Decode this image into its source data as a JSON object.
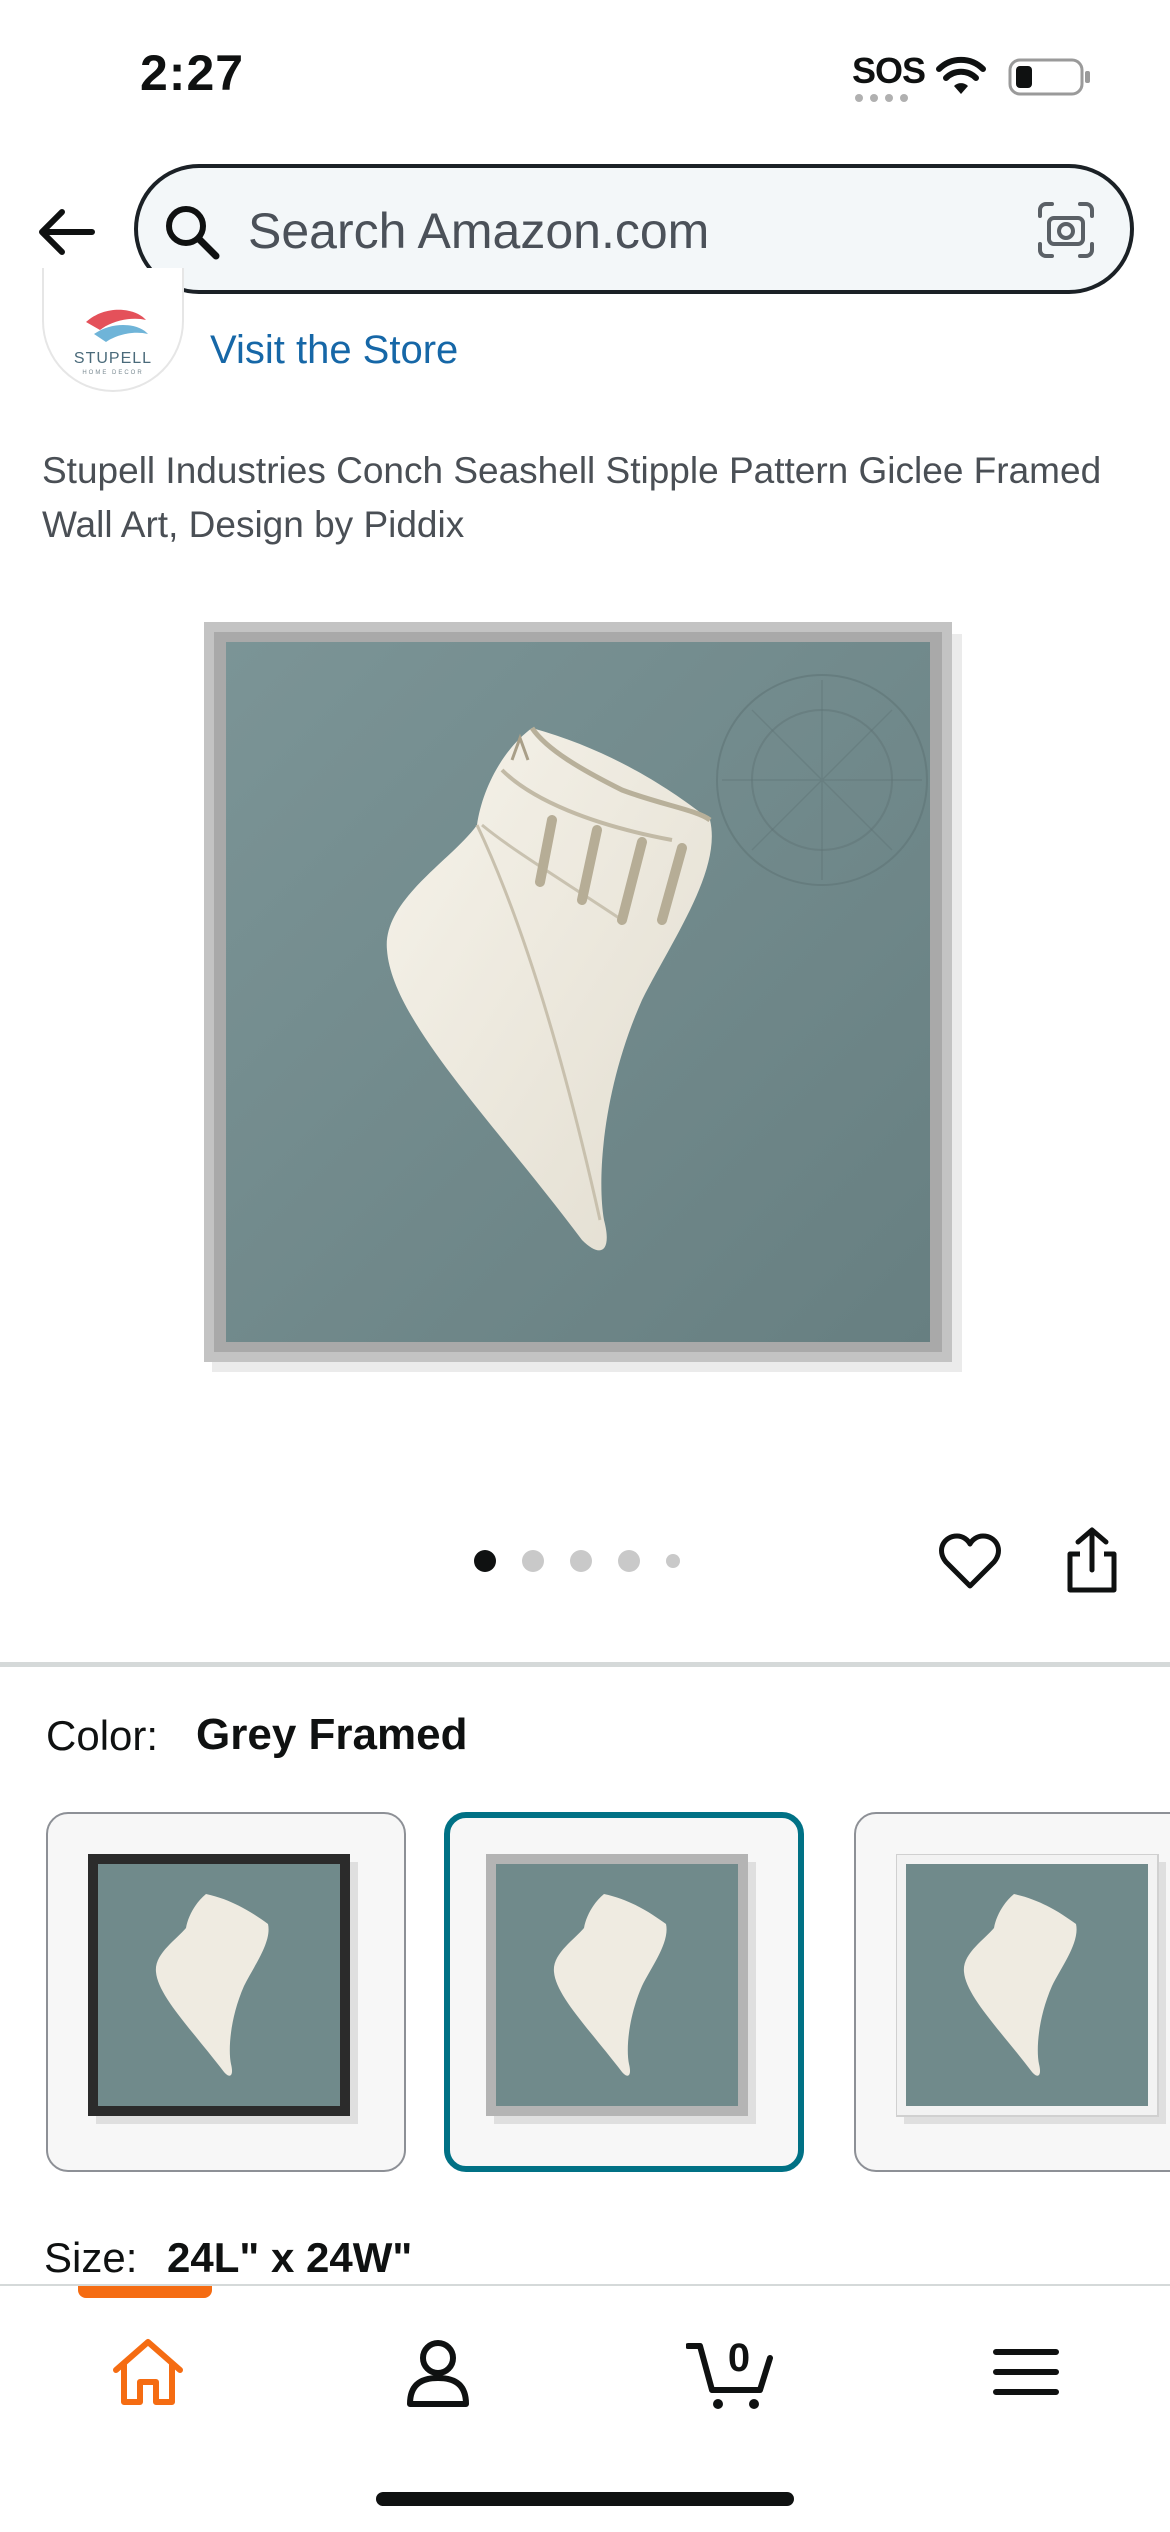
{
  "status_bar": {
    "time": "2:27",
    "carrier": "SOS"
  },
  "search": {
    "placeholder": "Search Amazon.com"
  },
  "store": {
    "logo_text": "STUPELL",
    "logo_subtext": "HOME DECOR",
    "link_label": "Visit the Store"
  },
  "product": {
    "title": "Stupell Industries Conch Seashell Stipple Pattern Giclee Framed Wall Art, Design by Piddix",
    "image_count": 5,
    "active_image": 1
  },
  "variation": {
    "color_label": "Color:",
    "color_value": "Grey Framed",
    "swatches": [
      {
        "name": "Black Framed",
        "frame_color": "#2b2b2b",
        "selected": false
      },
      {
        "name": "Grey Framed",
        "frame_color": "#b4b4b4",
        "selected": true
      },
      {
        "name": "White Framed",
        "frame_color": "#f2f2f2",
        "selected": false
      }
    ],
    "size_label": "Size:",
    "size_value": "24L\" x 24W\""
  },
  "bottom_nav": {
    "items": [
      {
        "icon": "home-icon",
        "active": true
      },
      {
        "icon": "account-icon",
        "active": false
      },
      {
        "icon": "cart-icon",
        "active": false
      },
      {
        "icon": "menu-icon",
        "active": false
      }
    ],
    "cart_count": "0"
  },
  "colors": {
    "accent_orange": "#f56c12",
    "link_blue": "#1667a7",
    "selected_teal": "#007185",
    "art_background": "#708a8b"
  }
}
